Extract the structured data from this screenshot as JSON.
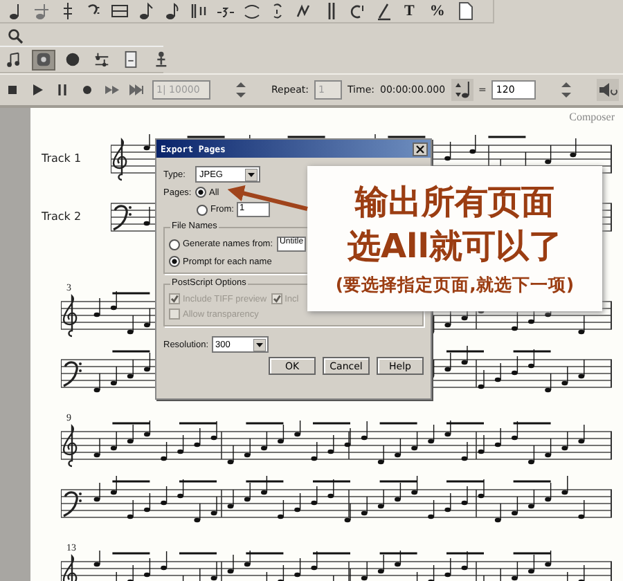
{
  "note_toolbar": {
    "items": [
      {
        "kind": "icon"
      },
      {
        "kind": "icon"
      },
      {
        "kind": "icon"
      },
      {
        "kind": "icon"
      },
      {
        "kind": "icon"
      },
      {
        "kind": "icon"
      },
      {
        "kind": "icon"
      },
      {
        "kind": "icon"
      },
      {
        "kind": "icon"
      },
      {
        "kind": "icon"
      },
      {
        "kind": "icon"
      },
      {
        "kind": "icon"
      },
      {
        "kind": "icon"
      },
      {
        "kind": "icon"
      },
      {
        "kind": "icon"
      },
      {
        "kind": "text",
        "label": "T"
      },
      {
        "kind": "text",
        "label": "%"
      },
      {
        "kind": "icon"
      }
    ]
  },
  "tool_palette": [
    {
      "selected": false
    },
    {
      "selected": true
    },
    {
      "selected": false
    },
    {
      "selected": false
    },
    {
      "selected": false
    },
    {
      "selected": false
    }
  ],
  "transport": {
    "position_value": "1| 10000",
    "position_disabled": true,
    "repeat_label": "Repeat:",
    "repeat_value": "1",
    "time_label": "Time:",
    "time_value": "00:00:00.000",
    "equals": "=",
    "tempo_value": "120"
  },
  "score": {
    "composer": "Composer",
    "systems": [
      {
        "tracks": [
          "Track 1",
          "Track 2"
        ]
      },
      {
        "measure": "3"
      },
      {
        "measure": "9"
      },
      {
        "measure": "13"
      }
    ]
  },
  "export_dialog": {
    "title": "Export Pages",
    "type_label": "Type:",
    "type_value": "JPEG",
    "pages_label": "Pages:",
    "pages_options": [
      {
        "label": "All",
        "selected": true
      },
      {
        "label": "From:",
        "selected": false
      }
    ],
    "from_value": "1",
    "file_names": {
      "title": "File Names",
      "name_value": "Untitle",
      "options": [
        {
          "label": "Generate names from:",
          "selected": false
        },
        {
          "label": "Prompt for each name",
          "selected": true
        }
      ]
    },
    "postscript": {
      "title": "PostScript Options",
      "options": [
        {
          "label": "Include TIFF preview",
          "checked": true,
          "disabled": true
        },
        {
          "label": "Incl",
          "checked": true,
          "disabled": true
        },
        {
          "label": "Allow transparency",
          "checked": false,
          "disabled": true
        }
      ]
    },
    "resolution_label": "Resolution:",
    "resolution_value": "300",
    "buttons": [
      "OK",
      "Cancel",
      "Help"
    ]
  },
  "callout": {
    "lines": [
      "输出所有页面",
      "选All就可以了"
    ],
    "note": "(要选择指定页面,就选下一项)"
  }
}
